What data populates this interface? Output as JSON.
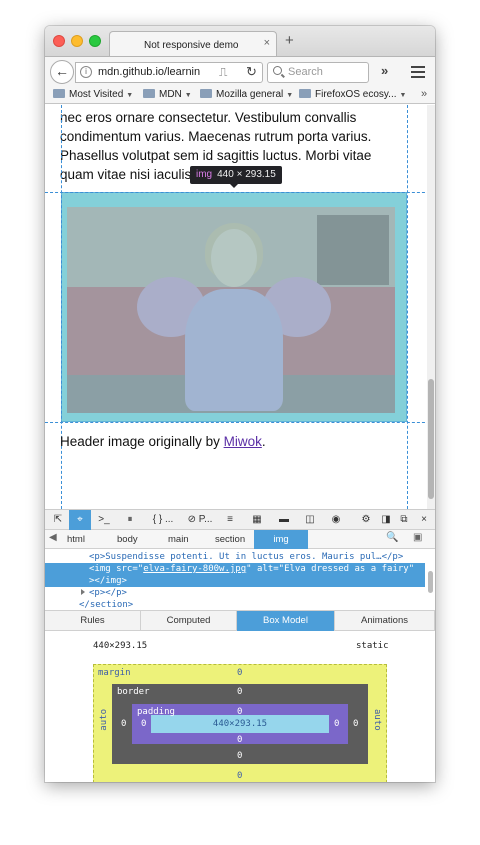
{
  "browser": {
    "tab_title": "Not responsive demo",
    "tab_close_icon": "×",
    "new_tab_icon": "+",
    "back_icon": "←",
    "info_icon": "i",
    "url": "mdn.github.io/learnin",
    "reader_icon": "⎍",
    "reload_icon": "↻",
    "search_placeholder": "Search",
    "overflow_icon": "»"
  },
  "bookmarks": [
    {
      "label": "Most Visited"
    },
    {
      "label": "MDN"
    },
    {
      "label": "Mozilla general"
    },
    {
      "label": "FirefoxOS ecosy..."
    }
  ],
  "bookmarks_more": "»",
  "page": {
    "paragraph": "nec eros ornare consectetur. Vestibulum convallis condimentum varius. Maecenas rutrum porta varius. Phasellus volutpat sem id sagittis luctus. Morbi vitae quam vitae nisi iaculis dignissi",
    "tooltip_tag": "img",
    "tooltip_size": "440 × 293.15",
    "caption_prefix": "Header image originally by ",
    "caption_link": "Miwok",
    "caption_suffix": "."
  },
  "devtools": {
    "toolbar": {
      "picker": "⇱",
      "inspector": "⌖",
      "console": ">_",
      "debugger": "⏸",
      "style_editor": "{ } ...",
      "performance": "⊘ P...",
      "network": "≡",
      "responsive": "▦",
      "storage": "▬",
      "scratchpad": "◫",
      "screenshot": "◉",
      "settings": "⚙",
      "dock_side": "◨",
      "dock_window": "⧉",
      "close": "×"
    },
    "breadcrumbs": [
      "html",
      "body",
      "main",
      "section",
      "img"
    ],
    "breadcrumb_search_icon": "🔍",
    "markup": {
      "line1": "<p>Suspendisse potenti. Ut in luctus eros. Mauris pul…</p>",
      "line2_open": "<img src=\"",
      "line2_src": "elva-fairy-800w.jpg",
      "line2_rest": "\" alt=\"Elva dressed as a fairy\"",
      "line3": "></img>",
      "line4": "<p></p>",
      "line5": "</section>"
    },
    "side_tabs": [
      "Rules",
      "Computed",
      "Box Model",
      "Animations"
    ],
    "active_side_tab": "Box Model",
    "box_model": {
      "dimensions": "440×293.15",
      "position": "static",
      "margin_label": "margin",
      "border_label": "border",
      "padding_label": "padding",
      "margin_top": "0",
      "margin_bottom": "0",
      "margin_left": "auto",
      "margin_right": "auto",
      "border_top": "0",
      "border_bottom": "0",
      "border_left": "0",
      "border_right": "0",
      "padding_top": "0",
      "padding_bottom": "0",
      "padding_left": "0",
      "padding_right": "0",
      "content": "440×293.15"
    }
  },
  "colors": {
    "accent": "#4c9ed9",
    "margin_box": "#edf27a",
    "border_box": "#5c5c5c",
    "padding_box": "#7b67c9",
    "content_box": "#96d6ec"
  }
}
